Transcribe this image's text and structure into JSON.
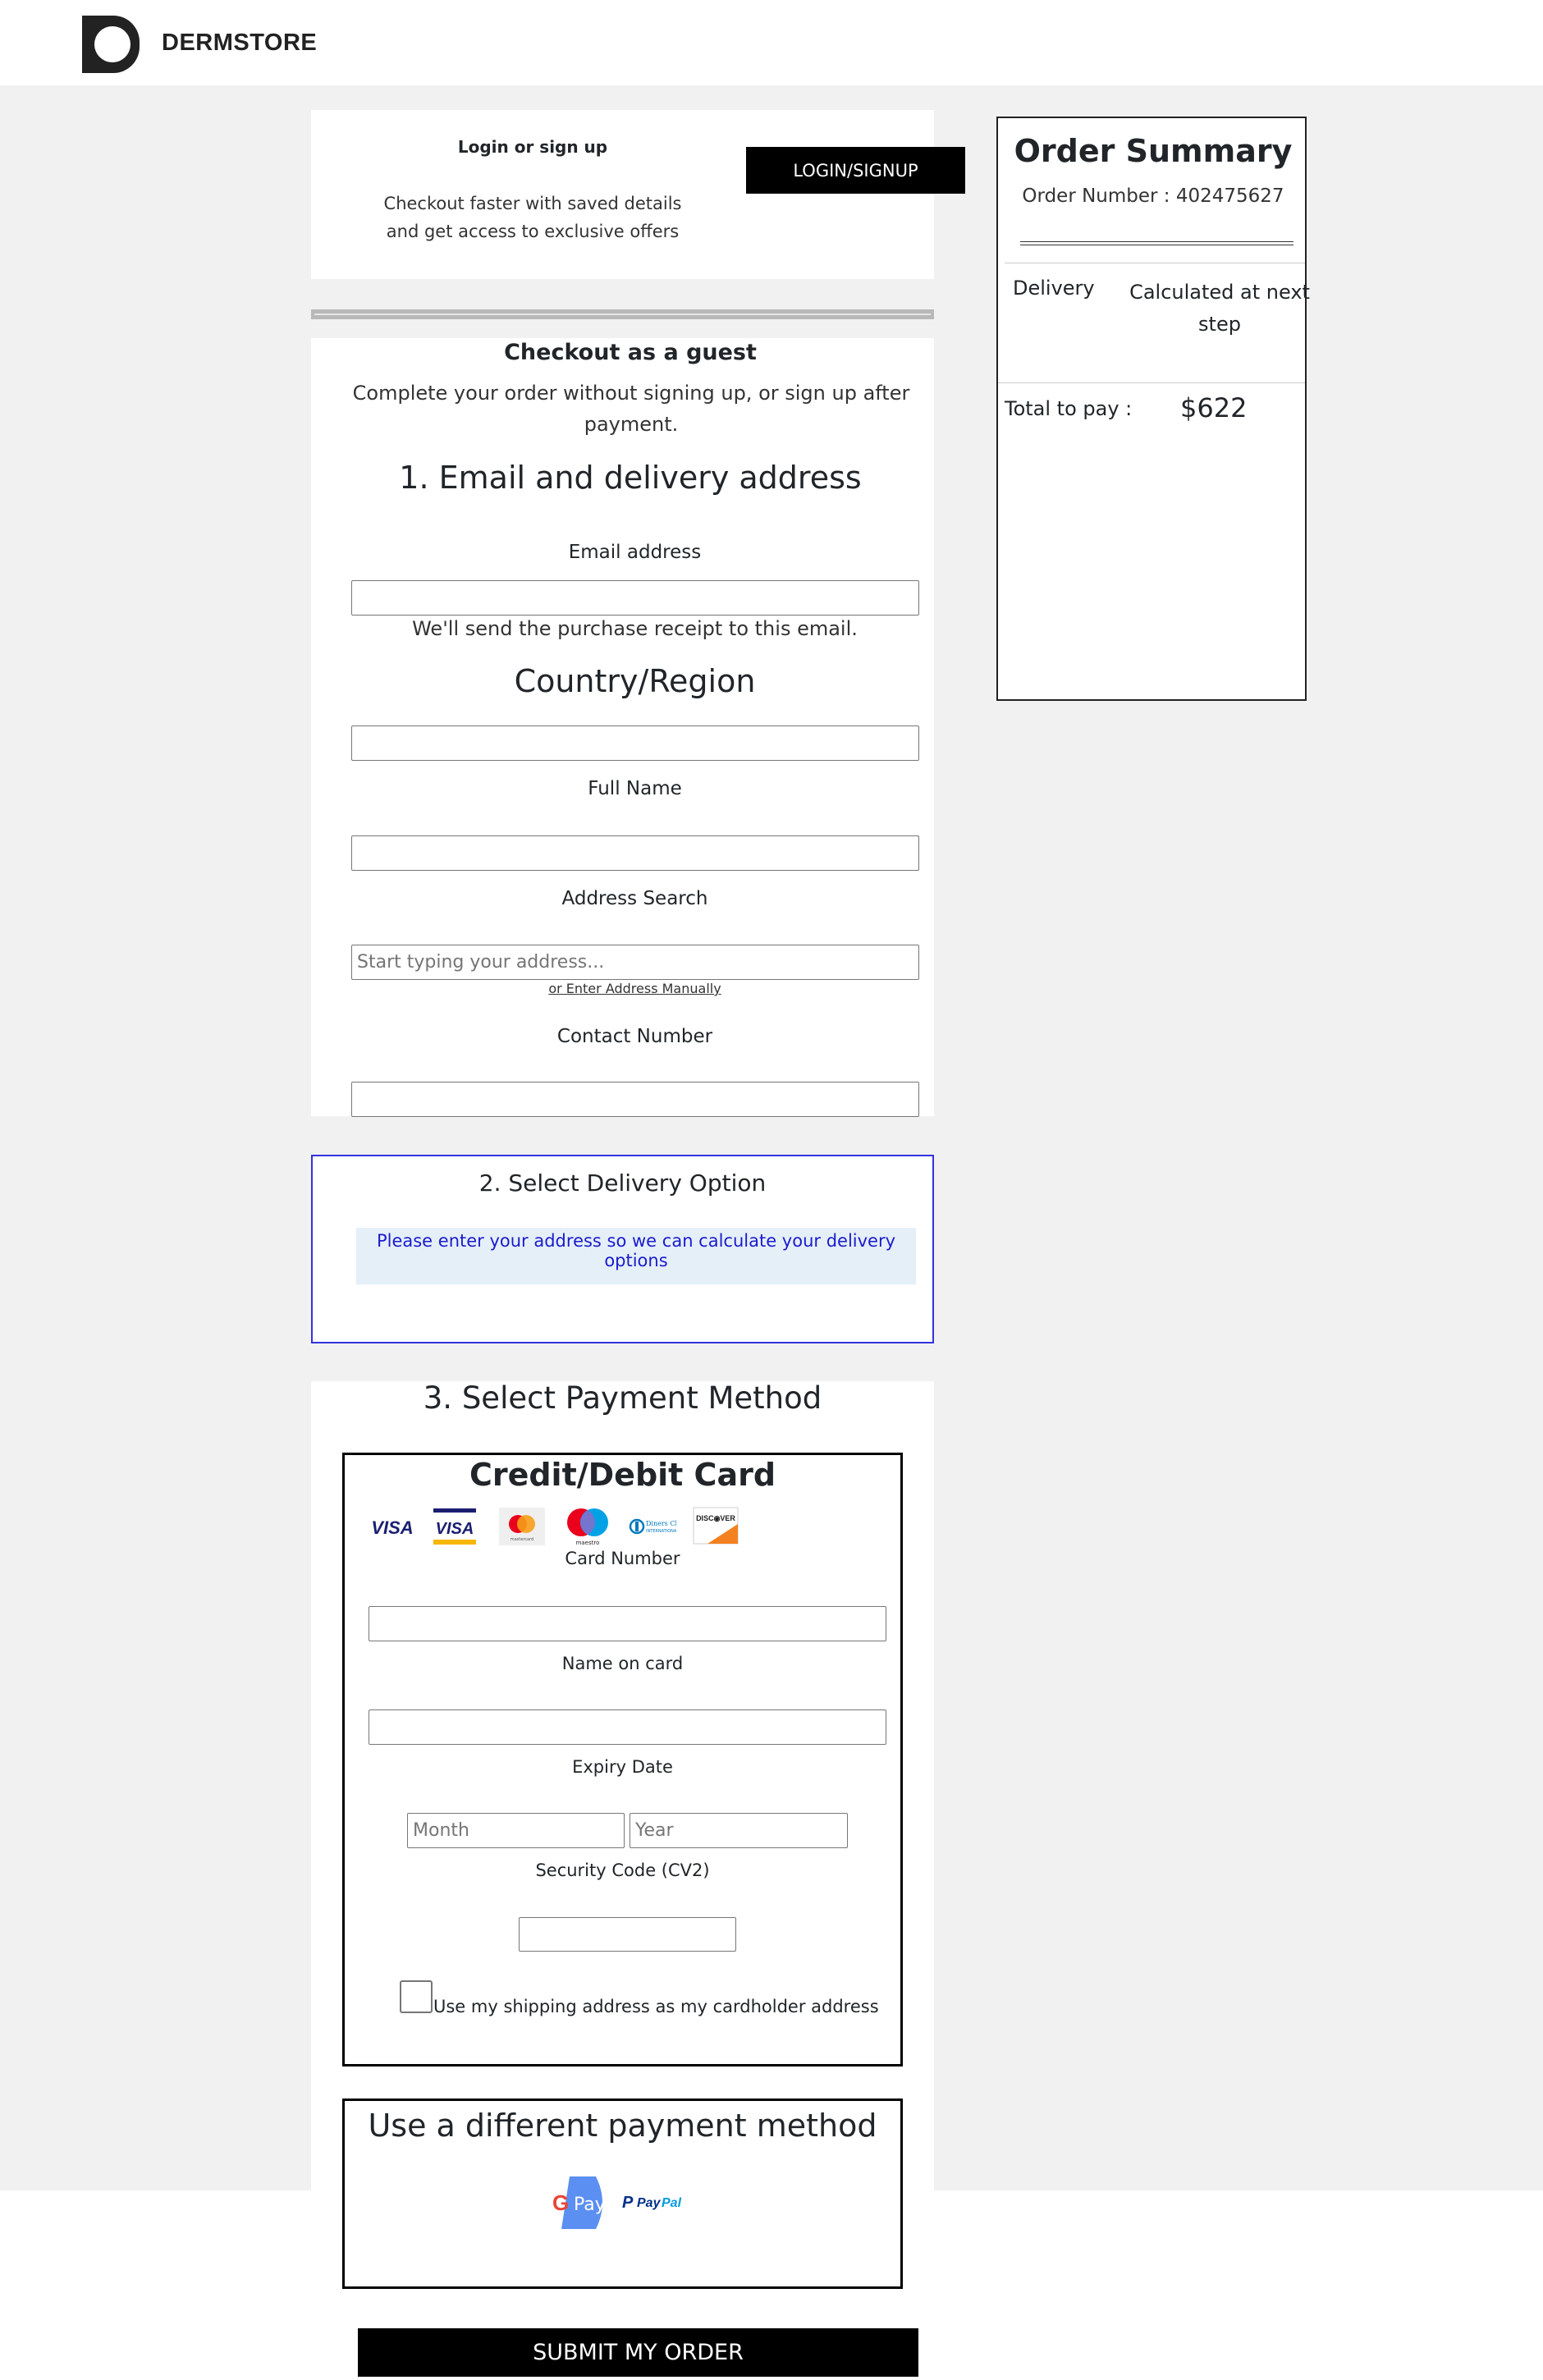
{
  "brand": {
    "name": "DERMSTORE",
    "logo_icon": "dermstore-d-logo"
  },
  "login": {
    "title": "Login or sign up",
    "description": "Checkout faster with saved details and get access to exclusive offers",
    "button_label": "LOGIN/SIGNUP"
  },
  "guest": {
    "title": "Checkout as a guest",
    "description": "Complete your order without signing up, or sign up after payment."
  },
  "section1": {
    "title": "1. Email and delivery address",
    "email_label": "Email address",
    "email_value": "",
    "email_hint": "We'll send the purchase receipt to this email.",
    "country_title": "Country/Region",
    "country_value": "",
    "fullname_label": "Full Name",
    "fullname_value": "",
    "address_label": "Address Search",
    "address_placeholder": "Start typing your address...",
    "manual_link": "or Enter Address Manually",
    "contact_label": "Contact Number",
    "contact_value": ""
  },
  "section2": {
    "title": "2. Select Delivery Option",
    "message": "Please enter your address so we can calculate your delivery options"
  },
  "section3": {
    "title": "3. Select Payment Method",
    "card": {
      "title": "Credit/Debit Card",
      "logos": [
        "visa",
        "visa-classic",
        "mastercard",
        "maestro",
        "diners-club",
        "discover"
      ],
      "card_number_label": "Card Number",
      "name_label": "Name on card",
      "expiry_label": "Expiry Date",
      "month_placeholder": "Month",
      "year_placeholder": "Year",
      "cvv_label": "Security Code (CV2)",
      "same_address_label": "Use my shipping address as my cardholder address",
      "same_address_checked": false
    },
    "alternative": {
      "title": "Use a different payment method",
      "options": [
        "Google Pay",
        "PayPal"
      ]
    }
  },
  "submit_label": "SUBMIT MY ORDER",
  "summary": {
    "title": "Order Summary",
    "order_number_text": "Order Number : 402475627",
    "delivery_label": "Delivery",
    "delivery_value": "Calculated at next step",
    "total_label": "Total to pay :",
    "total_value": "$622"
  },
  "colors": {
    "background": "#f1f1f1",
    "button": "#000000",
    "delivery_border": "#3333dd",
    "delivery_message_bg": "#e5eff8",
    "delivery_message_text": "#1b1bcc"
  }
}
